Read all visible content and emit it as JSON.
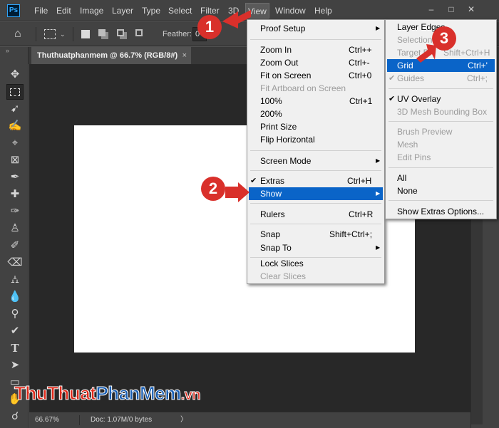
{
  "app": {
    "logo": "Ps"
  },
  "menubar": {
    "items": [
      "File",
      "Edit",
      "Image",
      "Layer",
      "Type",
      "Select",
      "Filter",
      "3D",
      "View",
      "Window",
      "Help"
    ],
    "active": "View"
  },
  "options": {
    "feather_label": "Feather:",
    "feather_value": "0"
  },
  "document": {
    "tab_title": "Thuthuatphanmem @ 66.7% (RGB/8#)",
    "tab_close": "×"
  },
  "statusbar": {
    "zoom": "66.67%",
    "doc_info": "Doc: 1.07M/0 bytes",
    "arrow": "〉"
  },
  "view_menu": {
    "proof_setup": "Proof Setup",
    "zoom_in": "Zoom In",
    "zoom_in_sc": "Ctrl++",
    "zoom_out": "Zoom Out",
    "zoom_out_sc": "Ctrl+-",
    "fit_on_screen": "Fit on Screen",
    "fit_on_screen_sc": "Ctrl+0",
    "fit_artboard": "Fit Artboard on Screen",
    "p100": "100%",
    "p100_sc": "Ctrl+1",
    "p200": "200%",
    "print_size": "Print Size",
    "flip_horizontal": "Flip Horizontal",
    "screen_mode": "Screen Mode",
    "extras": "Extras",
    "extras_sc": "Ctrl+H",
    "show": "Show",
    "rulers": "Rulers",
    "rulers_sc": "Ctrl+R",
    "snap": "Snap",
    "snap_sc": "Shift+Ctrl+;",
    "snap_to": "Snap To",
    "lock_slices": "Lock Slices",
    "clear_slices": "Clear Slices"
  },
  "show_menu": {
    "layer_edges": "Layer Edges",
    "selection_edges": "Selection E",
    "target_path": "Target P",
    "target_path_sc": "Shift+Ctrl+H",
    "grid": "Grid",
    "grid_sc": "Ctrl+'",
    "guides": "Guides",
    "guides_sc": "Ctrl+;",
    "uv_overlay": "UV Overlay",
    "mesh_bounding_box": "3D Mesh Bounding Box",
    "brush_preview": "Brush Preview",
    "mesh": "Mesh",
    "edit_pins": "Edit Pins",
    "all": "All",
    "none": "None",
    "show_extras_options": "Show Extras Options..."
  },
  "annotations": {
    "step1": "1",
    "step2": "2",
    "step3": "3"
  },
  "watermark": {
    "part1": "ThuThuat",
    "part2": "PhanMem",
    "part3": ".vn"
  },
  "colors": {
    "highlight": "#0a64c8",
    "badge": "#d9302b",
    "watermark_red": "#e02a1b",
    "watermark_blue": "#1a5fb4"
  }
}
